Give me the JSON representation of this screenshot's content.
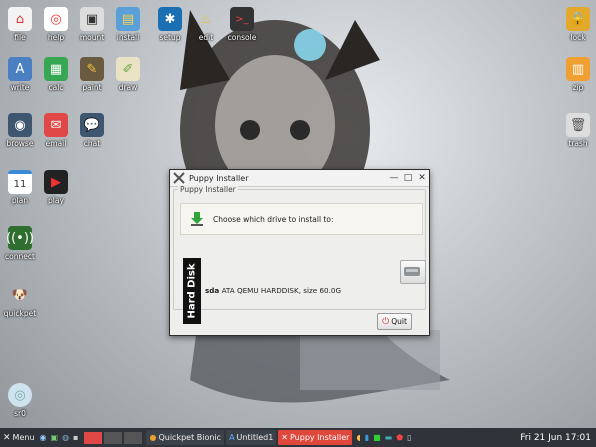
{
  "desktop_icons": {
    "file": "file",
    "help": "help",
    "mount": "mount",
    "install": "install",
    "setup": "setup",
    "edit": "edit",
    "console": "console",
    "lock": "lock",
    "write": "write",
    "calc": "calc",
    "paint": "paint",
    "draw": "draw",
    "zip": "zip",
    "browse": "browse",
    "email": "email",
    "chat": "chat",
    "trash": "trash",
    "plan": "plan",
    "plan_day": "11",
    "play": "play",
    "connect": "connect",
    "quickpet": "quickpet",
    "sr0": "sr0"
  },
  "window": {
    "title": "Puppy Installer",
    "group_label": "Puppy Installer",
    "prompt": "Choose which drive to install to:",
    "tab_label": "Hard Disk",
    "drive_name": "sda",
    "drive_desc": "ATA QEMU HARDDISK, size 60.0G",
    "quit_label": "Quit"
  },
  "taskbar": {
    "menu_label": "Menu",
    "tasks": [
      {
        "label": "Quickpet Bionic"
      },
      {
        "label": "Untitled1"
      },
      {
        "label": "Puppy Installer"
      }
    ],
    "clock": "Fri 21 Jun 17:01"
  },
  "colors": {
    "taskbar": "#2f343a",
    "active_task": "#e0473b",
    "accent_red": "#d83b32"
  }
}
